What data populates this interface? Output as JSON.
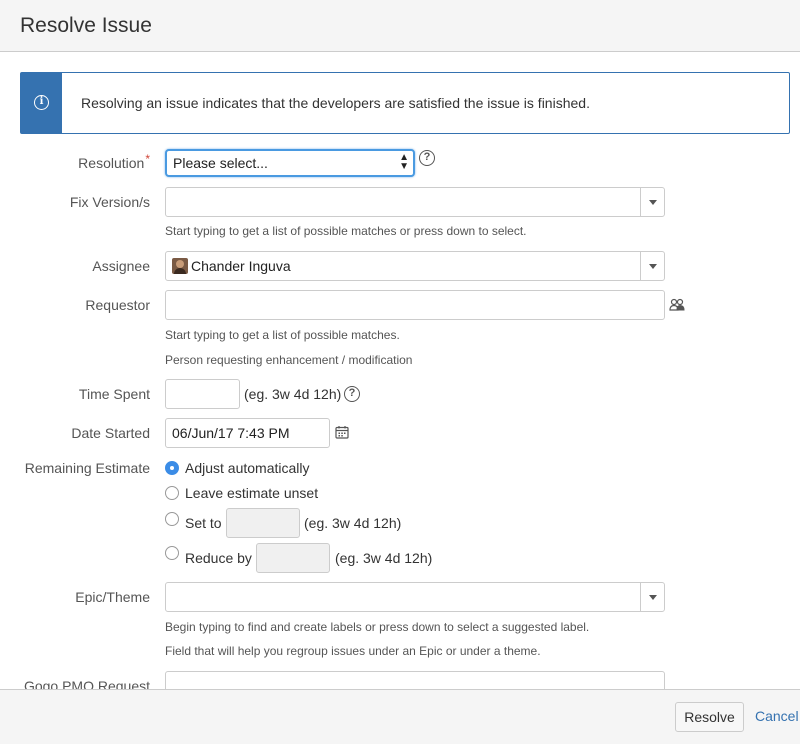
{
  "dialog": {
    "title": "Resolve Issue",
    "info_message": "Resolving an issue indicates that the developers are satisfied the issue is finished."
  },
  "fields": {
    "resolution": {
      "label": "Resolution",
      "required_marker": "*",
      "value": "Please select..."
    },
    "fix_version": {
      "label": "Fix Version/s",
      "value": "",
      "hint": "Start typing to get a list of possible matches or press down to select."
    },
    "assignee": {
      "label": "Assignee",
      "value": "Chander Inguva"
    },
    "requestor": {
      "label": "Requestor",
      "value": "",
      "hint1": "Start typing to get a list of possible matches.",
      "hint2": "Person requesting enhancement / modification"
    },
    "time_spent": {
      "label": "Time Spent",
      "value": "",
      "example": "(eg. 3w 4d 12h)"
    },
    "date_started": {
      "label": "Date Started",
      "value": "06/Jun/17 7:43 PM"
    },
    "remaining_estimate": {
      "label": "Remaining Estimate",
      "options": [
        {
          "label": "Adjust automatically",
          "checked": true
        },
        {
          "label": "Leave estimate unset",
          "checked": false
        },
        {
          "label": "Set to",
          "checked": false,
          "example": "(eg. 3w 4d 12h)"
        },
        {
          "label": "Reduce by",
          "checked": false,
          "example": "(eg. 3w 4d 12h)"
        }
      ]
    },
    "epic_theme": {
      "label": "Epic/Theme",
      "value": "",
      "hint1": "Begin typing to find and create labels or press down to select a suggested label.",
      "hint2": "Field that will help you regroup issues under an Epic or under a theme."
    },
    "gogo_pmo": {
      "label": "Gogo PMO Request"
    }
  },
  "footer": {
    "resolve_label": "Resolve",
    "cancel_label": "Cancel"
  },
  "colors": {
    "accent": "#3572b0",
    "required": "#d04437",
    "radio_checked": "#3b8ce6"
  }
}
